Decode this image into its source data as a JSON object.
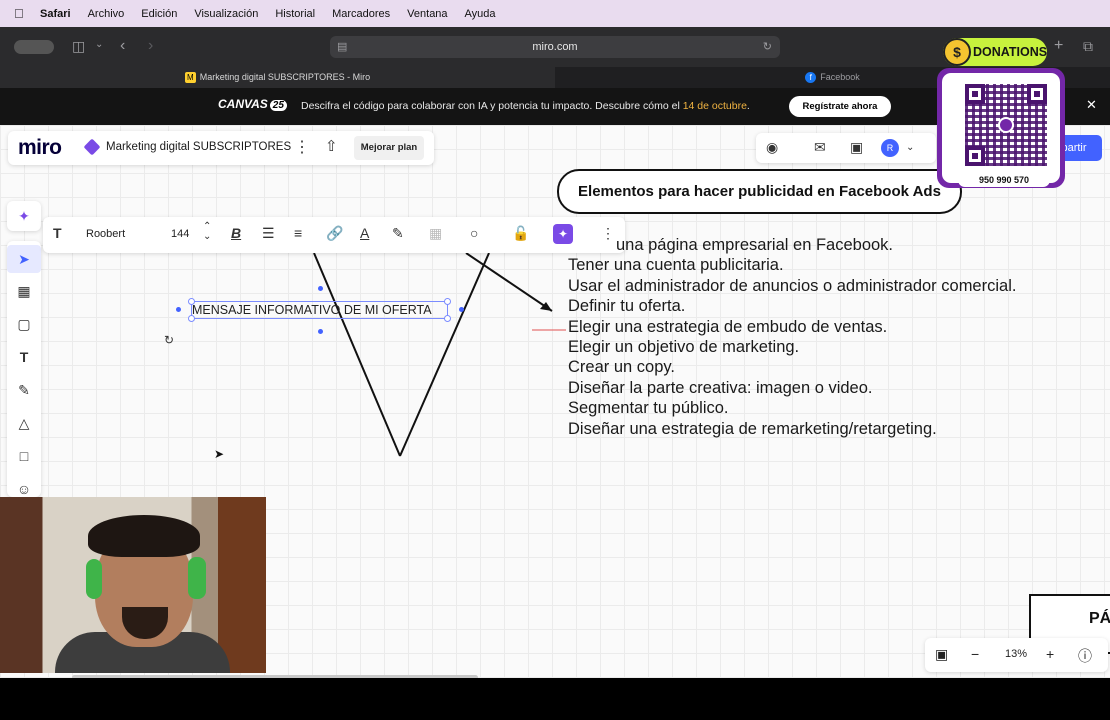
{
  "menubar": {
    "items": [
      "Safari",
      "Archivo",
      "Edición",
      "Visualización",
      "Historial",
      "Marcadores",
      "Ventana",
      "Ayuda"
    ]
  },
  "browser": {
    "url": "miro.com",
    "tabs": [
      {
        "title": "Marketing digital SUBSCRIPTORES - Miro"
      },
      {
        "title": "Facebook"
      }
    ]
  },
  "banner": {
    "logo": "CANVAS",
    "logo_badge": "25",
    "text": "Descifra el código para colaborar con IA y potencia tu impacto. Descubre cómo el ",
    "date": "14 de octubre",
    "date_suffix": ".",
    "button": "Regístrate ahora"
  },
  "miro": {
    "logo": "miro",
    "board_name": "Marketing digital SUBSCRIPTORES",
    "upgrade_label": "Mejorar plan",
    "avatar_initial": "R",
    "share_label": "partir"
  },
  "text_toolbar": {
    "font": "Roobert",
    "size": "144"
  },
  "board": {
    "title": "Elementos para hacer publicidad en Facebook Ads",
    "steps": [
      "una página empresarial en Facebook.",
      "Tener una cuenta publicitaria.",
      "Usar el administrador de anuncios o administrador comercial.",
      "Definir tu oferta.",
      "Elegir una estrategia de embudo de ventas.",
      "Elegir un objetivo de marketing.",
      "Crear un copy.",
      "Diseñar la parte creativa: imagen o video.",
      "Segmentar tu público.",
      "Diseñar una estrategia de remarketing/retargeting."
    ],
    "selected_text": "MENSAJE INFORMATIVO DE MI OFERTA",
    "partial_box": "PÁ"
  },
  "zoom": {
    "value": "13%"
  },
  "overlay": {
    "donations": "DONATIONS",
    "phone": "950 990 570",
    "qr_label": "yape"
  },
  "colors": {
    "accent": "#4262ff",
    "ai_purple": "#7a4ae6",
    "banner_date": "#f0b341",
    "donations_green": "#c7f23d",
    "yape_purple": "#7327a8"
  }
}
